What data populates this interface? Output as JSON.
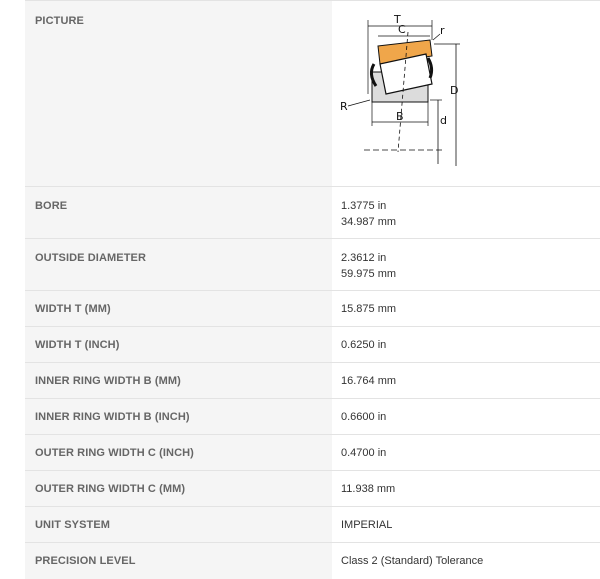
{
  "rows": [
    {
      "label": "PICTURE"
    },
    {
      "label": "BORE",
      "value_line1": "1.3775 in",
      "value_line2": "34.987 mm"
    },
    {
      "label": "OUTSIDE DIAMETER",
      "value_line1": "2.3612 in",
      "value_line2": "59.975 mm"
    },
    {
      "label": "WIDTH T (MM)",
      "value": "15.875 mm"
    },
    {
      "label": "WIDTH T (INCH)",
      "value": "0.6250 in"
    },
    {
      "label": "INNER RING WIDTH B (MM)",
      "value": "16.764 mm"
    },
    {
      "label": "INNER RING WIDTH B (INCH)",
      "value": "0.6600 in"
    },
    {
      "label": "OUTER RING WIDTH C (INCH)",
      "value": "0.4700 in"
    },
    {
      "label": "OUTER RING WIDTH C (MM)",
      "value": "11.938 mm"
    },
    {
      "label": "UNIT SYSTEM",
      "value": "IMPERIAL"
    },
    {
      "label": "PRECISION LEVEL",
      "value": "Class 2 (Standard) Tolerance"
    }
  ],
  "diagram": {
    "labels": {
      "T": "T",
      "C": "C",
      "r": "r",
      "D": "D",
      "R": "R",
      "B": "B",
      "d": "d"
    },
    "colors": {
      "outer_ring": "#f0a64a",
      "inner_ring": "#dcdcdc",
      "line": "#111111"
    }
  }
}
